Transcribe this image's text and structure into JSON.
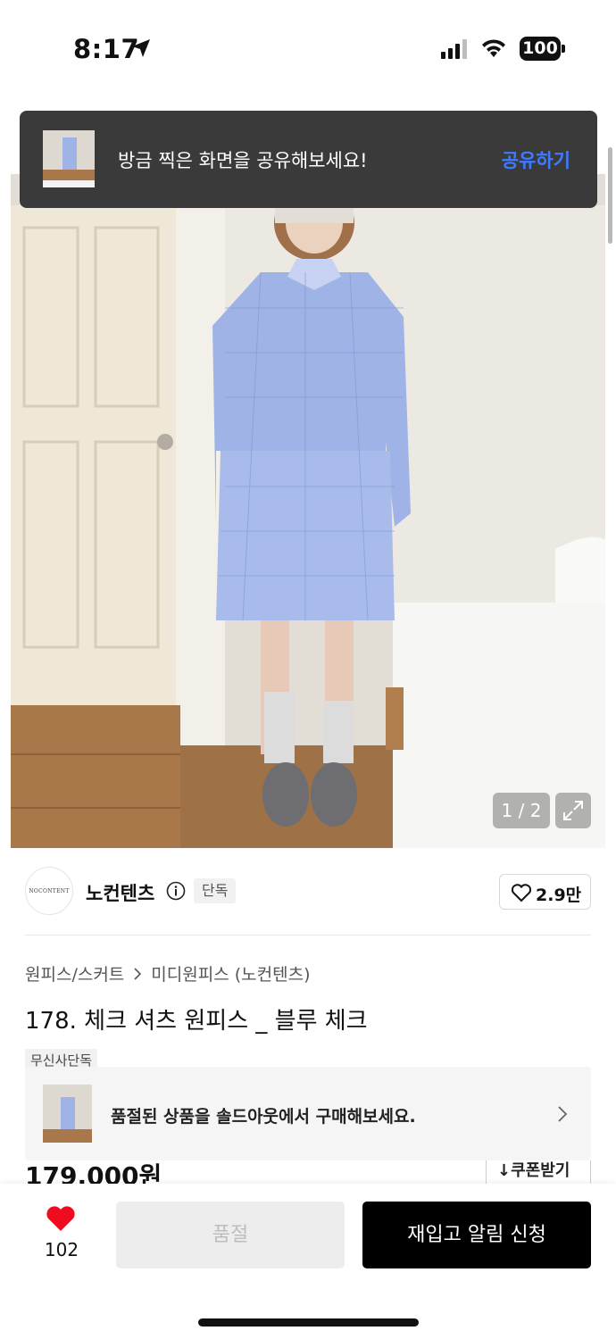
{
  "status_bar": {
    "time": "8:17",
    "battery": "100"
  },
  "toast": {
    "message": "방금 찍은 화면을 공유해보세요!",
    "action_label": "공유하기"
  },
  "gallery": {
    "page_indicator": "1 / 2"
  },
  "brand": {
    "logo_text": "NOCONTENT",
    "name": "노컨텐츠",
    "tag": "단독",
    "like_count": "2.9만"
  },
  "breadcrumb": {
    "category": "원피스/스커트",
    "subcategory": "미디원피스 (노컨텐츠)"
  },
  "product": {
    "title": "178. 체크 셔츠 원피스 _ 블루 체크",
    "badge": "무신사단독",
    "price": "179,000원",
    "coupon_label": "쿠폰받기"
  },
  "soldout_banner": {
    "text": "품절된 상품을 솔드아웃에서 구매해보세요."
  },
  "bottom_bar": {
    "wish_count": "102",
    "soldout_label": "품절",
    "restock_label": "재입고 알림 신청"
  },
  "colors": {
    "accent_blue": "#3d7bff",
    "heart_red": "#ef0c1f",
    "toast_bg": "#3a3a3a"
  }
}
